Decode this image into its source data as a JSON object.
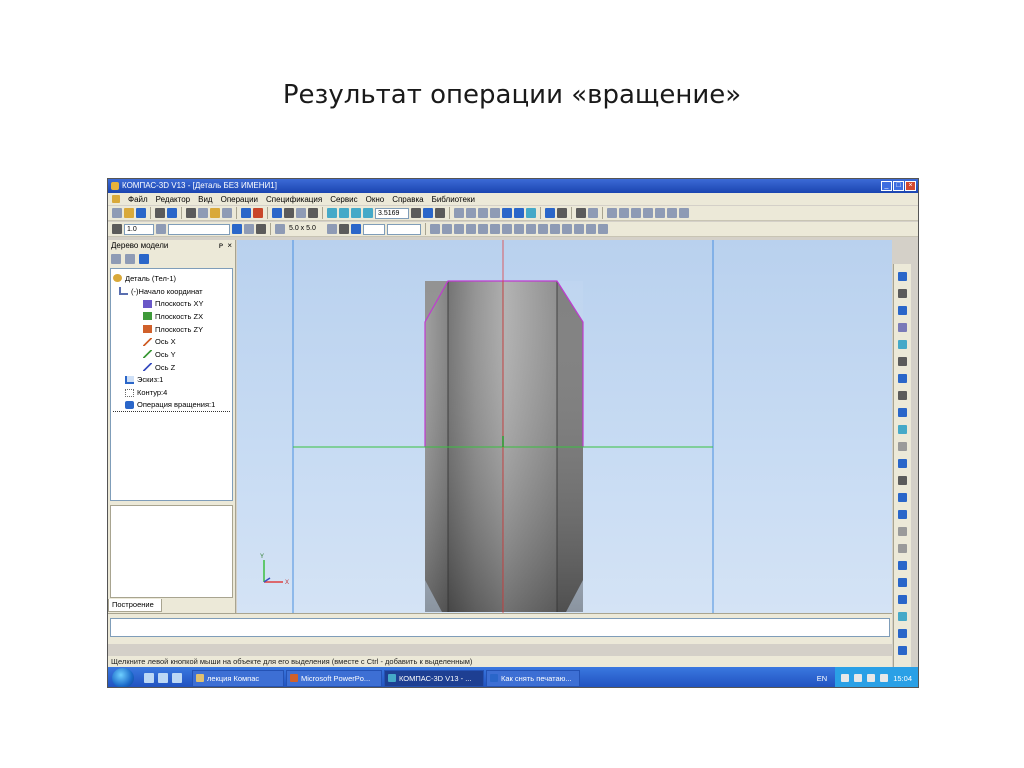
{
  "slide": {
    "title": "Результат операции «вращение»"
  },
  "window": {
    "title": "КОМПАС-3D V13 - [Деталь БЕЗ ИМЕНИ1]"
  },
  "menu": {
    "items": [
      "Файл",
      "Редактор",
      "Вид",
      "Операции",
      "Спецификация",
      "Сервис",
      "Окно",
      "Справка",
      "Библиотеки"
    ]
  },
  "toolbar": {
    "zoom_value": "3.5169",
    "scale_value": "1.0",
    "grid_value": "5.0 x 5.0"
  },
  "model_tree": {
    "header": "Дерево модели",
    "pin": "ᴘ",
    "close": "×",
    "items": [
      {
        "label": "Деталь (Тел-1)",
        "icon_color": "#d9a93a"
      },
      {
        "label": "(-)Начало координат",
        "icon_color": "#5a6fb0"
      },
      {
        "label": "Плоскость XY",
        "icon_color": "#6a58c8"
      },
      {
        "label": "Плоскость ZX",
        "icon_color": "#3f9a3a"
      },
      {
        "label": "Плоскость ZY",
        "icon_color": "#d0602a"
      },
      {
        "label": "Ось X",
        "icon_color": "#d0602a"
      },
      {
        "label": "Ось Y",
        "icon_color": "#3f9a3a"
      },
      {
        "label": "Ось Z",
        "icon_color": "#3a4fc0"
      },
      {
        "label": "Эскиз:1",
        "icon_color": "#2a66c9"
      },
      {
        "label": "Контур:4",
        "icon_color": "#6b6b6b"
      },
      {
        "label": "Операция вращения:1",
        "icon_color": "#2a66c9"
      }
    ],
    "tab": "Построение"
  },
  "axes_labels": {
    "y": "Y",
    "x": "X"
  },
  "status": {
    "text": "Щелкните левой кнопкой мыши на объекте для его выделения (вместе с Ctrl - добавить к выделенным)"
  },
  "taskbar": {
    "buttons": [
      {
        "label": "лекция Компас",
        "active": false
      },
      {
        "label": "Microsoft PowerPo...",
        "active": false
      },
      {
        "label": "КОМПАС-3D V13 - ...",
        "active": true
      },
      {
        "label": "Как снять печатаю...",
        "active": false
      }
    ],
    "lang": "EN",
    "time": "15:04"
  },
  "colors": {
    "viewport_bg": "#c7dbf3",
    "part_light": "#a9a9a9",
    "part_dark": "#5f5f5f",
    "sketch_outline": "#c03ad0",
    "axis_green": "#3ac040",
    "axis_red": "#e04040",
    "guide_blue": "#4a90e0"
  }
}
